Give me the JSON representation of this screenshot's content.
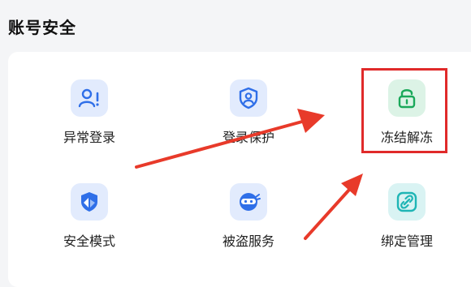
{
  "section": {
    "title": "账号安全"
  },
  "items": [
    {
      "label": "异常登录",
      "icon": "user-alert-icon"
    },
    {
      "label": "登录保护",
      "icon": "shield-user-icon"
    },
    {
      "label": "冻结解冻",
      "icon": "unlock-icon"
    },
    {
      "label": "安全模式",
      "icon": "shield-mode-icon"
    },
    {
      "label": "被盗服务",
      "icon": "ninja-icon"
    },
    {
      "label": "绑定管理",
      "icon": "link-icon"
    }
  ],
  "colors": {
    "icon_blue": "#2f6fe8",
    "icon_green": "#1aa85a",
    "icon_teal": "#1fb5b5",
    "highlight_red": "#e02a2a"
  }
}
